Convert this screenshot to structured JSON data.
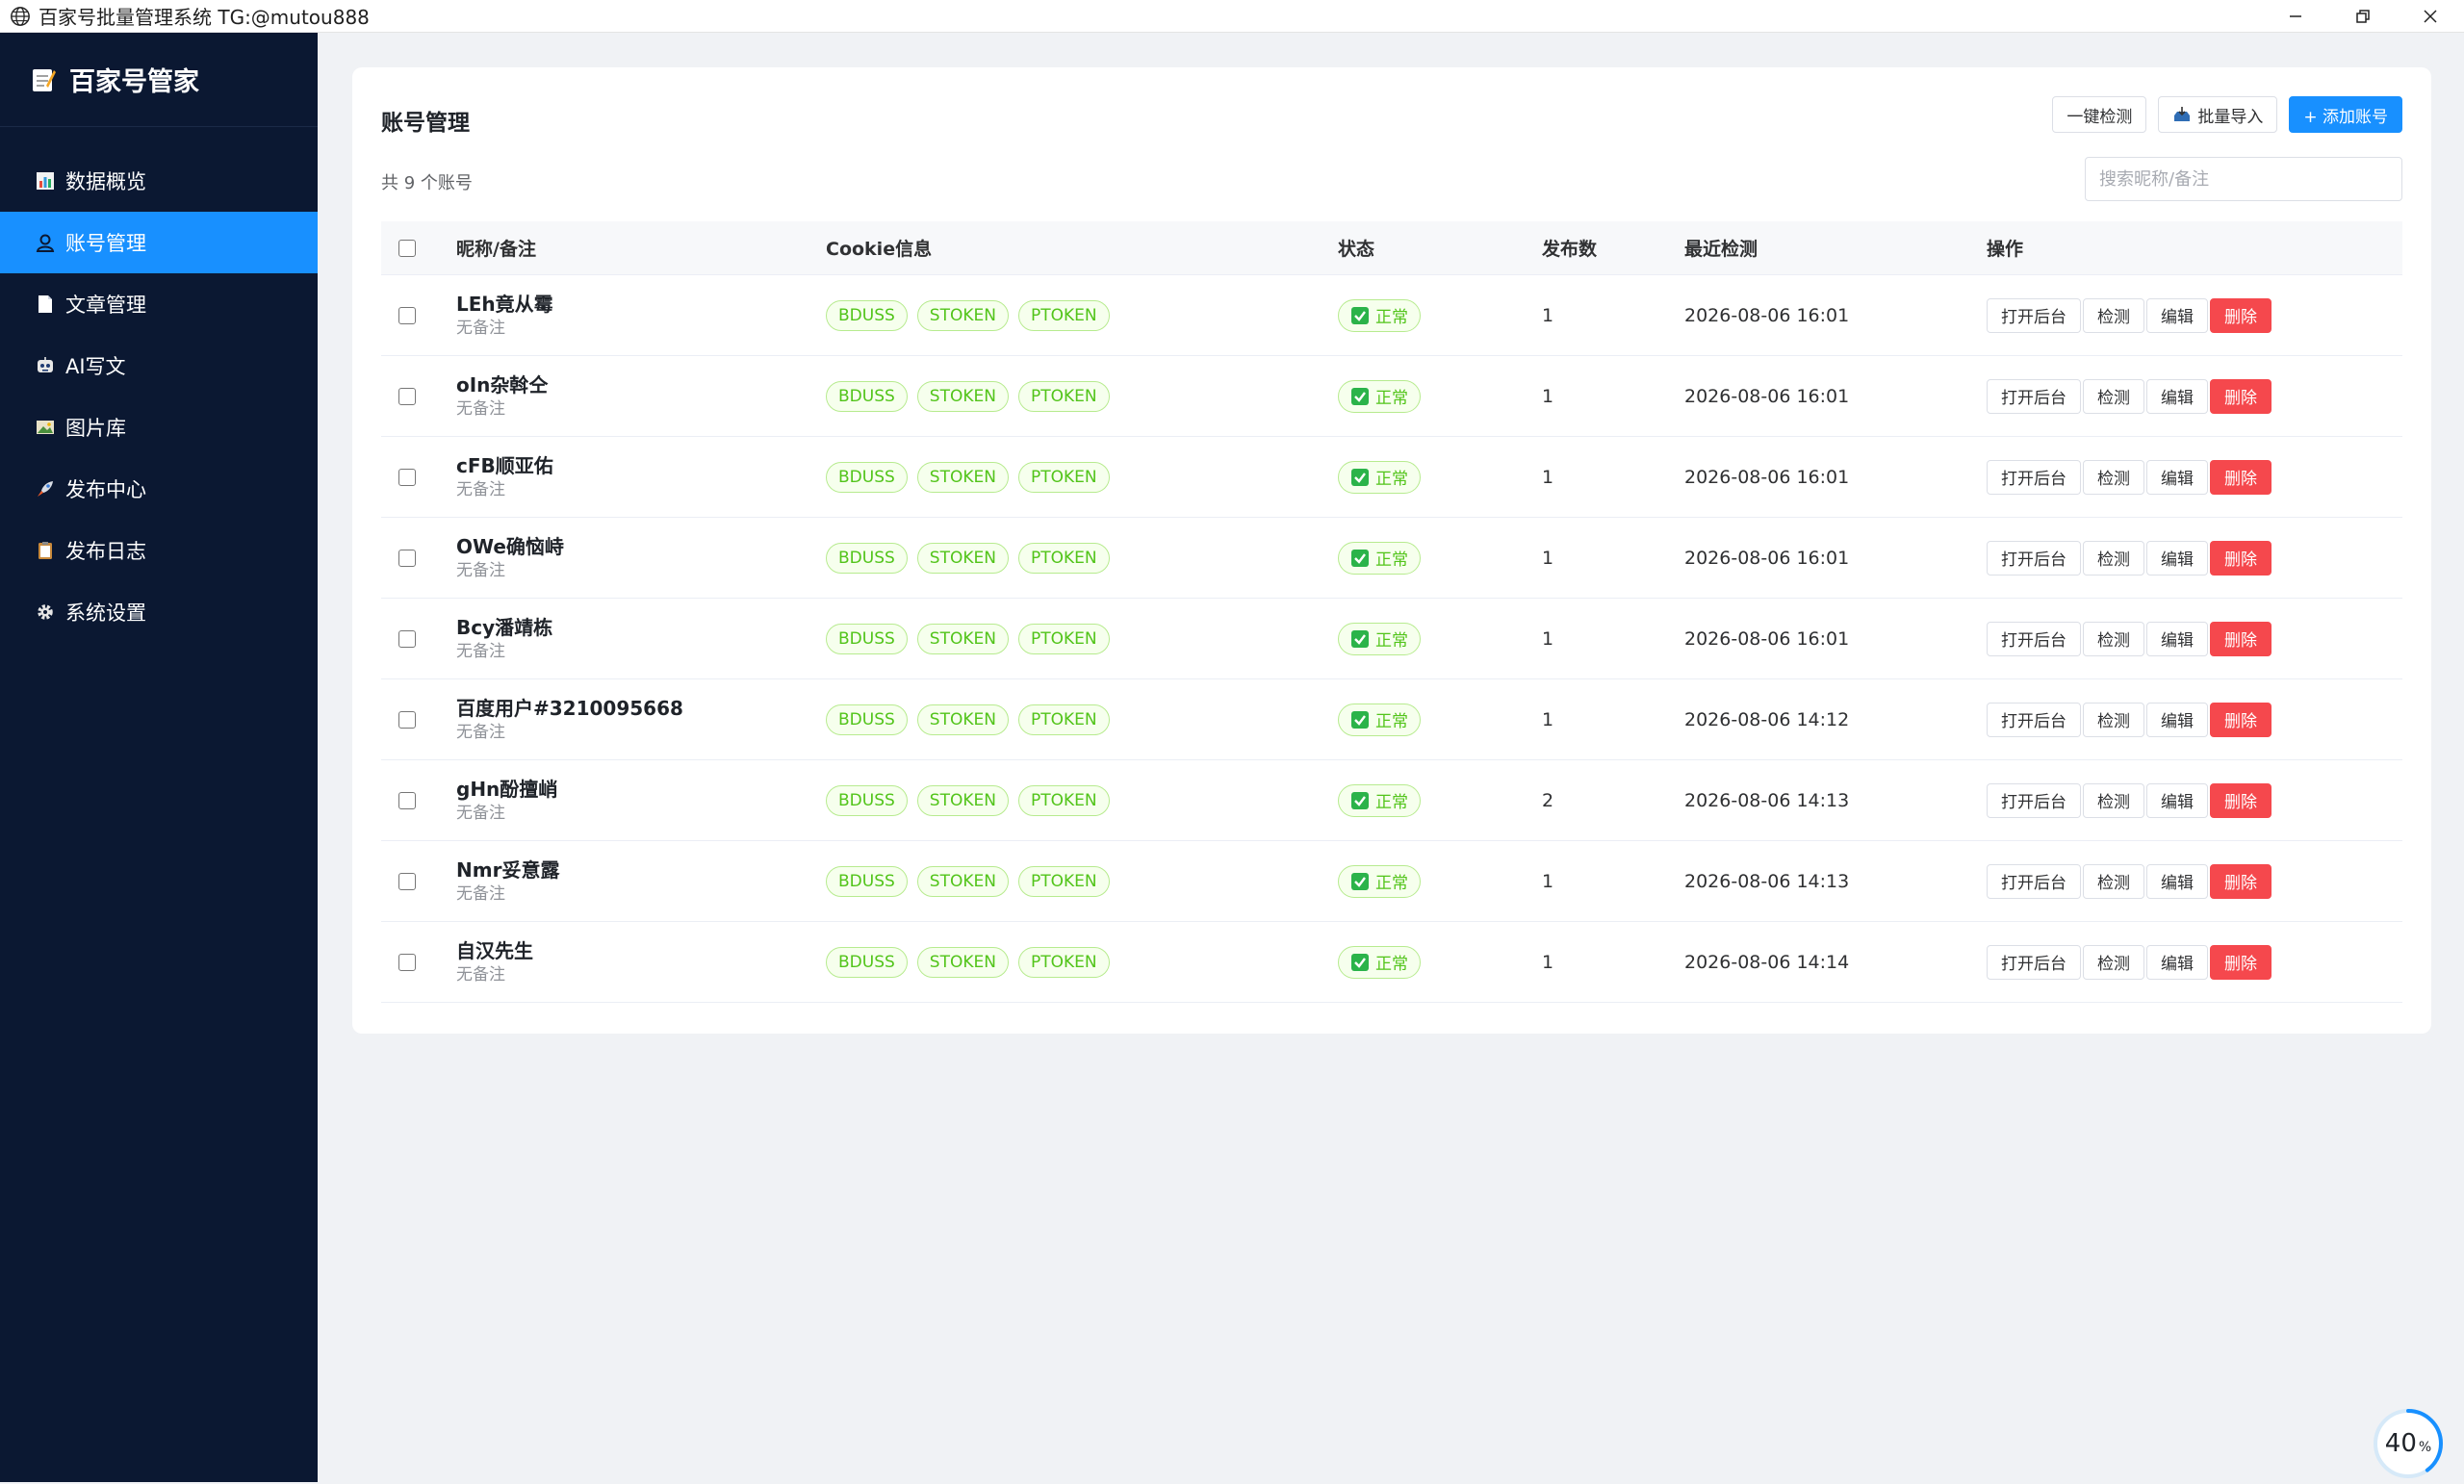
{
  "window": {
    "title": "百家号批量管理系统 TG:@mutou888"
  },
  "sidebar": {
    "brand": "百家号管家",
    "items": [
      {
        "label": "数据概览",
        "icon": "bar-chart-icon"
      },
      {
        "label": "账号管理",
        "icon": "user-icon",
        "active": true
      },
      {
        "label": "文章管理",
        "icon": "document-icon"
      },
      {
        "label": "AI写文",
        "icon": "robot-icon"
      },
      {
        "label": "图片库",
        "icon": "picture-icon"
      },
      {
        "label": "发布中心",
        "icon": "rocket-icon"
      },
      {
        "label": "发布日志",
        "icon": "clipboard-icon"
      },
      {
        "label": "系统设置",
        "icon": "gear-icon"
      }
    ]
  },
  "main": {
    "title": "账号管理",
    "toolbar": {
      "check_all": "一键检测",
      "import": "批量导入",
      "add": "+ 添加账号"
    },
    "count_text": "共 9 个账号",
    "search_placeholder": "搜索昵称/备注",
    "columns": [
      "昵称/备注",
      "Cookie信息",
      "状态",
      "发布数",
      "最近检测",
      "操作"
    ],
    "cookie_tags": [
      "BDUSS",
      "STOKEN",
      "PTOKEN"
    ],
    "actions": [
      "打开后台",
      "检测",
      "编辑",
      "删除"
    ],
    "rows": [
      {
        "name": "LEh竟从霉",
        "remark": "无备注",
        "status": "正常",
        "published": "1",
        "last_check": "2026-08-06 16:01"
      },
      {
        "name": "oIn杂斡仝",
        "remark": "无备注",
        "status": "正常",
        "published": "1",
        "last_check": "2026-08-06 16:01"
      },
      {
        "name": "cFB顺亚佑",
        "remark": "无备注",
        "status": "正常",
        "published": "1",
        "last_check": "2026-08-06 16:01"
      },
      {
        "name": "OWe确恼峙",
        "remark": "无备注",
        "status": "正常",
        "published": "1",
        "last_check": "2026-08-06 16:01"
      },
      {
        "name": "Bcy潘靖栋",
        "remark": "无备注",
        "status": "正常",
        "published": "1",
        "last_check": "2026-08-06 16:01"
      },
      {
        "name": "百度用户#3210095668",
        "remark": "无备注",
        "status": "正常",
        "published": "1",
        "last_check": "2026-08-06 14:12"
      },
      {
        "name": "gHn酚擅峭",
        "remark": "无备注",
        "status": "正常",
        "published": "2",
        "last_check": "2026-08-06 14:13"
      },
      {
        "name": "Nmr妥意露",
        "remark": "无备注",
        "status": "正常",
        "published": "1",
        "last_check": "2026-08-06 14:13"
      },
      {
        "name": "自汉先生",
        "remark": "无备注",
        "status": "正常",
        "published": "1",
        "last_check": "2026-08-06 14:14"
      }
    ]
  },
  "progress": {
    "value": "40",
    "unit": "%"
  },
  "colors": {
    "sidebar_bg": "#0b1832",
    "accent": "#1890ff",
    "success": "#52c41a",
    "danger": "#f5484d"
  }
}
